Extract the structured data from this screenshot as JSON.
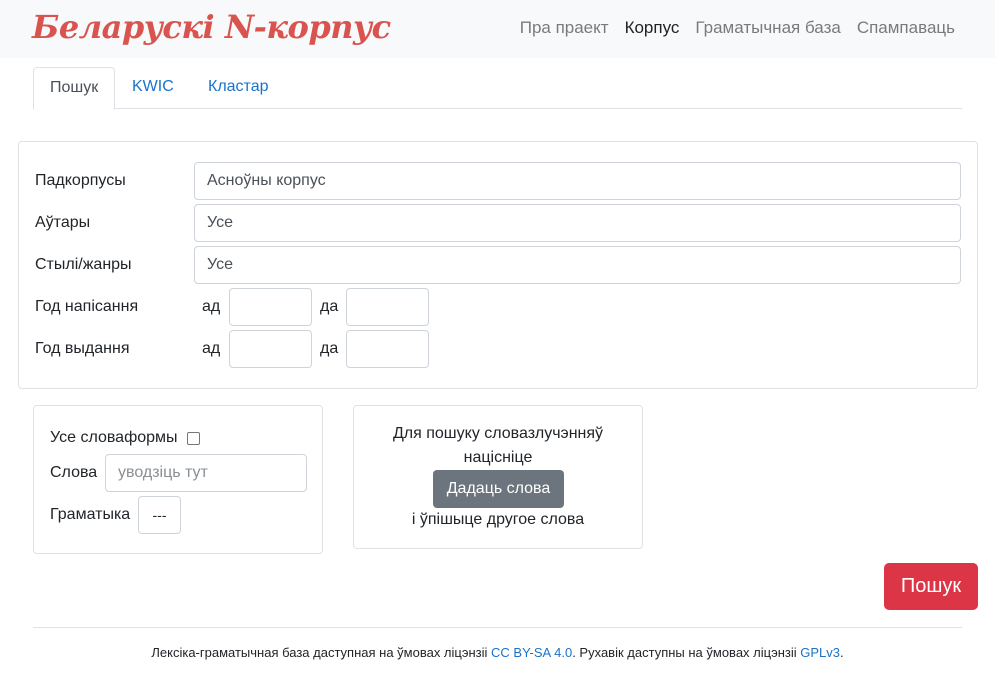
{
  "header": {
    "brand": "Беларускі N-корпус",
    "nav": [
      "Пра праект",
      "Корпус",
      "Граматычная база",
      "Спампаваць"
    ],
    "active_nav": "Корпус"
  },
  "tabs": [
    "Пошук",
    "KWIC",
    "Кластар"
  ],
  "filters": {
    "subcorpus_label": "Падкорпусы",
    "subcorpus_value": "Асноўны корпус",
    "authors_label": "Аўтары",
    "authors_value": "Усе",
    "styles_label": "Стылі/жанры",
    "styles_value": "Усе",
    "written_label": "Год напісання",
    "published_label": "Год выдання",
    "from": "ад",
    "to": "да"
  },
  "word": {
    "all_forms_label": "Усе словаформы",
    "words_label": "Слова",
    "words_placeholder": "уводзіць тут",
    "grammar_label": "Граматыка",
    "grammar_value": "---"
  },
  "add_word": {
    "text_line1": "Для пошуку словазлучэнняў",
    "text_line2": "націсніце",
    "button": "Дадаць слова",
    "text_after": "і ўпішыце другое слова"
  },
  "search_button": "Пошук",
  "footer": {
    "part1": "Лексіка-граматычная база даступная на ўмовах ліцэнзіі ",
    "link1": "CC BY-SA 4.0",
    "part2": ". Рухавік даступны на ўмовах ліцэнзіі ",
    "link2": "GPLv3",
    "part3": "."
  },
  "colors": {
    "brand": "#d9534f",
    "link": "#1a73c8",
    "danger": "#dc3545",
    "secondary": "#6c757d"
  }
}
